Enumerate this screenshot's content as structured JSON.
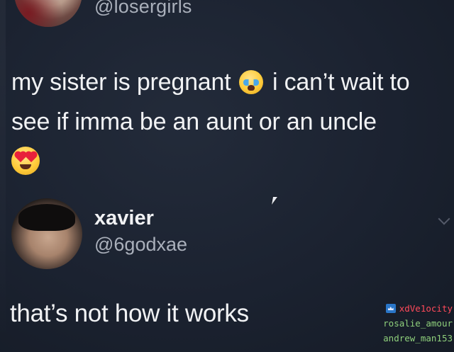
{
  "top_tweet": {
    "handle": "@losergirls",
    "text_part1": "my sister is pregnant",
    "text_part2": "i can’t wait to see if imma be an aunt or an uncle"
  },
  "reply_tweet": {
    "name": "xavier",
    "handle": "@6godxae",
    "text": "that’s not how it works"
  },
  "viewers": [
    {
      "name": "xdVe1ocity",
      "badge": "moderator-crown-icon",
      "color": "#ff4a5a"
    },
    {
      "name": "rosalie_amour",
      "color": "#8fd07c"
    },
    {
      "name": "andrew_man153",
      "color": "#8fd07c"
    }
  ],
  "icons": {
    "emoji1": "loudly-crying-face-emoji",
    "emoji2": "heart-eyes-face-emoji",
    "cursor": "mouse-cursor-icon",
    "menu": "chevron-down-icon"
  }
}
